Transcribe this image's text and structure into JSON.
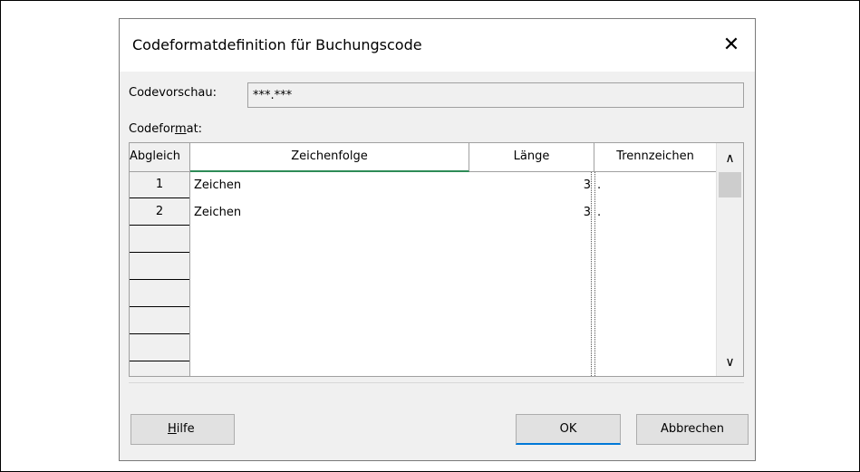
{
  "dialog": {
    "title": "Codeformatdefinition für Buchungscode",
    "close_glyph": "✕"
  },
  "preview": {
    "label": "Codevorschau:",
    "value": "***.***"
  },
  "format": {
    "label_prefix": "Codefor",
    "label_accel": "m",
    "label_suffix": "at:"
  },
  "grid": {
    "headers": {
      "match": "Abgleich",
      "sequence": "Zeichenfolge",
      "length": "Länge",
      "separator": "Trennzeichen"
    },
    "rows": [
      {
        "num": "1",
        "sequence": "Zeichen",
        "length": "3",
        "separator": "."
      },
      {
        "num": "2",
        "sequence": "Zeichen",
        "length": "3",
        "separator": "."
      },
      {
        "num": "",
        "sequence": "",
        "length": "",
        "separator": ""
      },
      {
        "num": "",
        "sequence": "",
        "length": "",
        "separator": ""
      },
      {
        "num": "",
        "sequence": "",
        "length": "",
        "separator": ""
      },
      {
        "num": "",
        "sequence": "",
        "length": "",
        "separator": ""
      },
      {
        "num": "",
        "sequence": "",
        "length": "",
        "separator": ""
      }
    ],
    "scroll_up": "∧",
    "scroll_down": "∨"
  },
  "buttons": {
    "help_accel": "H",
    "help_rest": "ilfe",
    "ok": "OK",
    "cancel": "Abbrechen"
  }
}
